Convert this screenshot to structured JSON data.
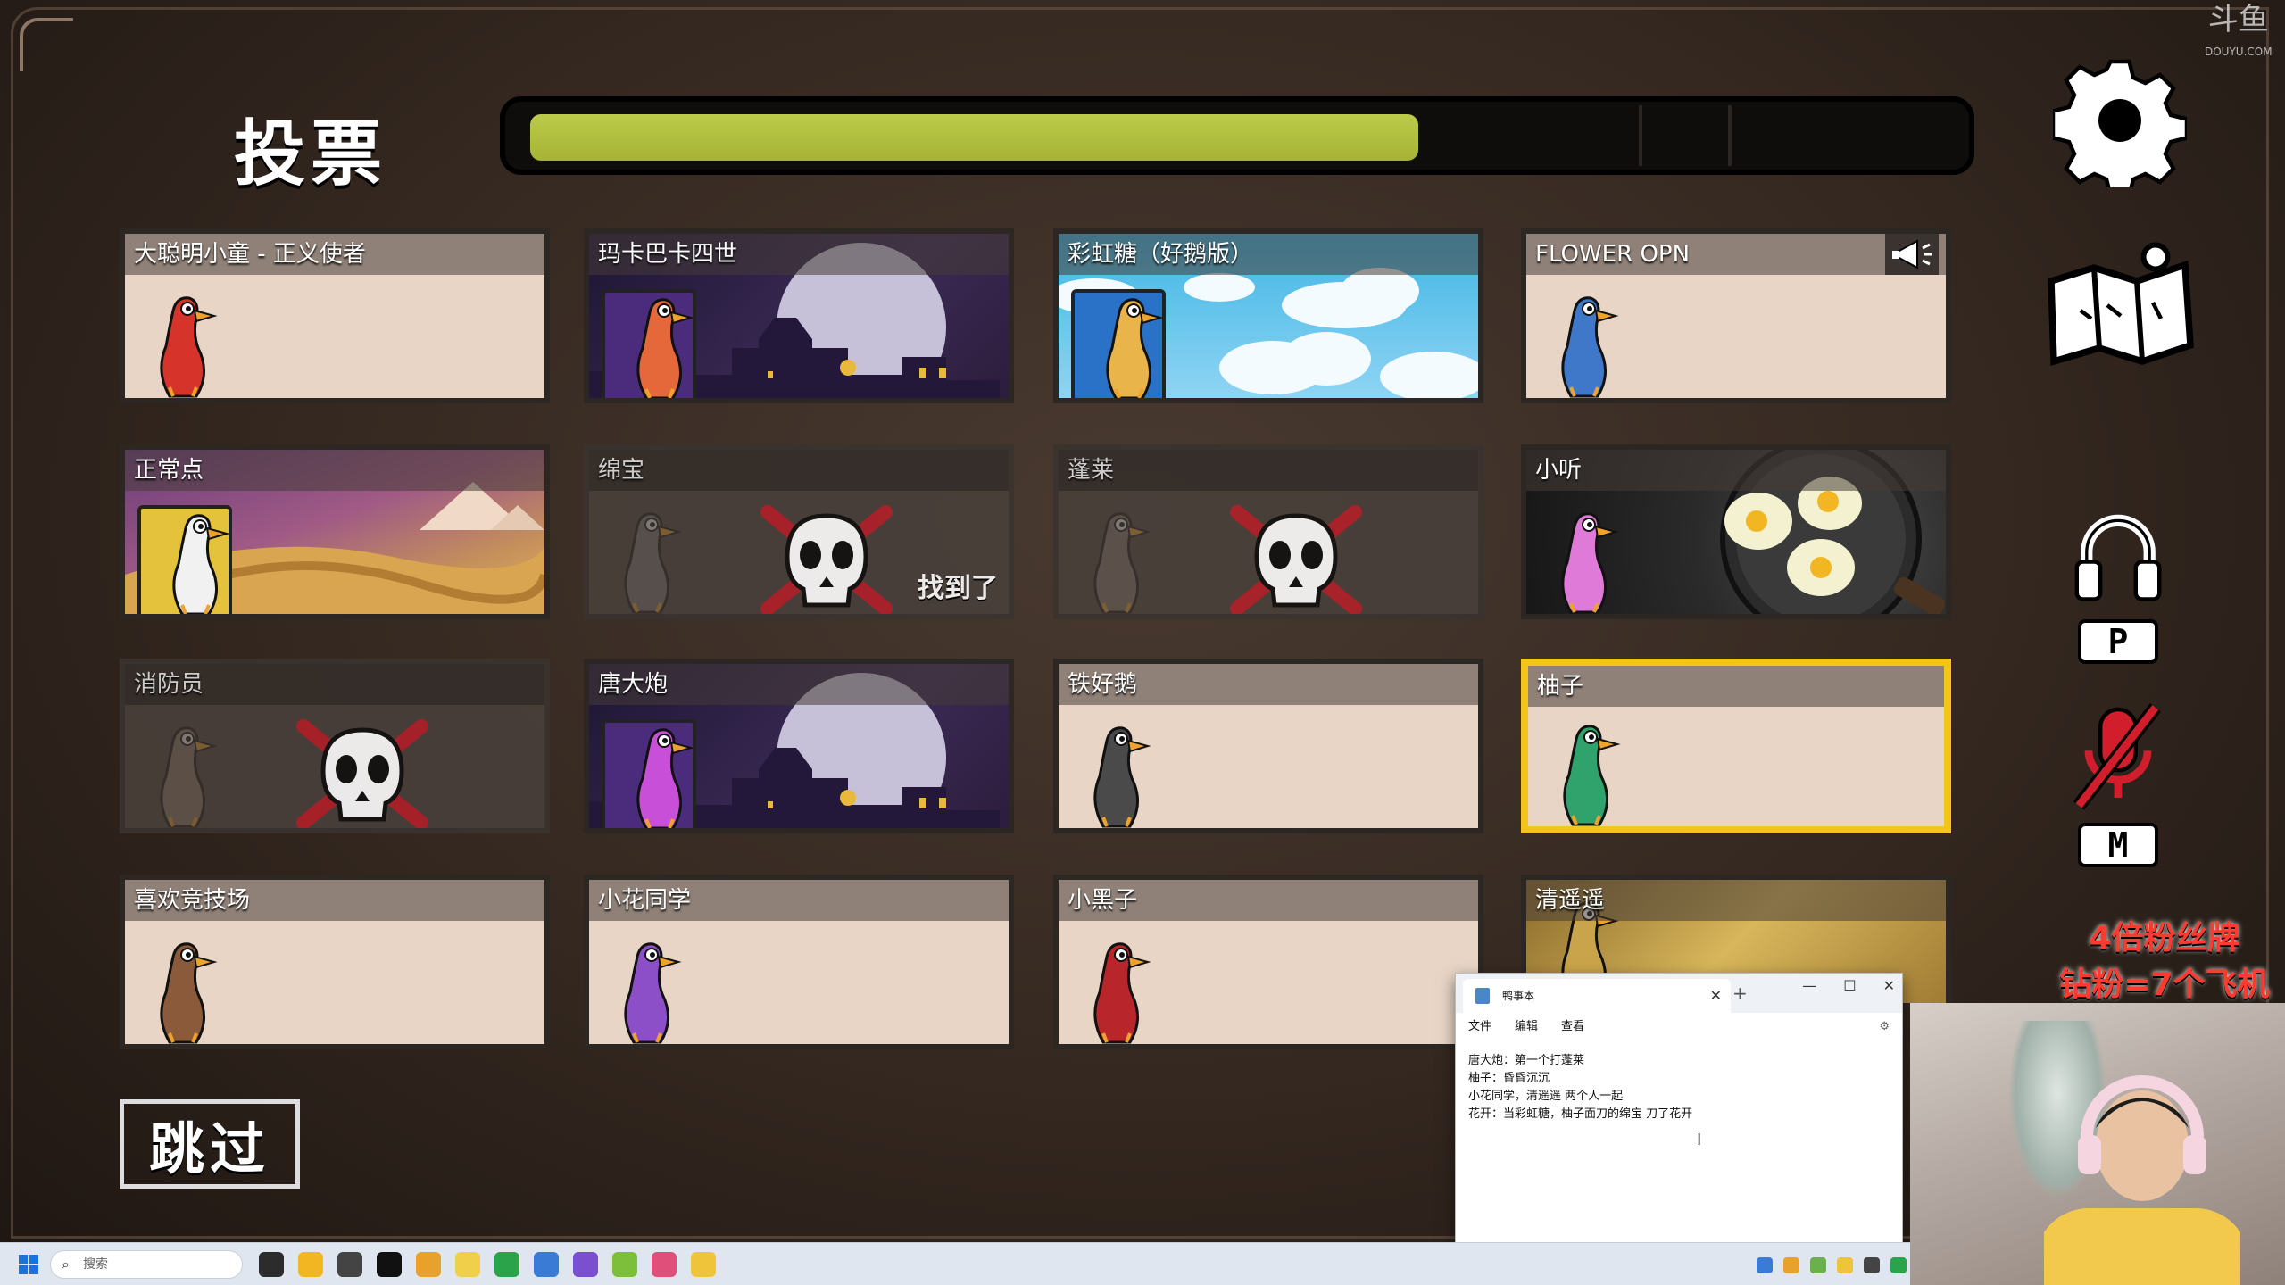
{
  "header": {
    "title": "投票",
    "timer_progress": 0.63
  },
  "players": [
    {
      "name": "大聪明小童 - 正义使者",
      "status": "alive",
      "bg": "plain",
      "goose_color": "#d6332b"
    },
    {
      "name": "玛卡巴卡四世",
      "status": "alive",
      "bg": "night",
      "goose_color": "#e4683a"
    },
    {
      "name": "彩虹糖（好鹅版）",
      "status": "alive",
      "bg": "sky",
      "goose_color": "#e9b54a"
    },
    {
      "name": "FLOWER OPN",
      "status": "alive",
      "bg": "plain",
      "goose_color": "#3f77c9",
      "megaphone": true
    },
    {
      "name": "正常点",
      "status": "alive",
      "bg": "desert",
      "goose_color": "#f1f1f1"
    },
    {
      "name": "绵宝",
      "status": "dead",
      "bg": "dead",
      "goose_color": "#777",
      "found_label": "找到了"
    },
    {
      "name": "蓬莱",
      "status": "dead",
      "bg": "dead",
      "goose_color": "#8a7a70"
    },
    {
      "name": "小听",
      "status": "alive",
      "bg": "pan",
      "goose_color": "#e07ad9"
    },
    {
      "name": "消防员",
      "status": "dead",
      "bg": "dead",
      "goose_color": "#8c7a6a"
    },
    {
      "name": "唐大炮",
      "status": "alive",
      "bg": "night",
      "goose_color": "#c84fd8"
    },
    {
      "name": "铁好鹅",
      "status": "alive",
      "bg": "plain",
      "goose_color": "#4a4a4a"
    },
    {
      "name": "柚子",
      "status": "alive",
      "bg": "plain",
      "goose_color": "#2fa36b",
      "selected": true
    },
    {
      "name": "喜欢竞技场",
      "status": "alive",
      "bg": "plain",
      "goose_color": "#8a5a3b"
    },
    {
      "name": "小花同学",
      "status": "alive",
      "bg": "plain",
      "goose_color": "#8c4fc8"
    },
    {
      "name": "小黑子",
      "status": "alive",
      "bg": "plain",
      "goose_color": "#b8252a"
    },
    {
      "name": "清遥遥",
      "status": "alive",
      "bg": "gold",
      "goose_color": "#c9a44b"
    }
  ],
  "skip_label": "跳过",
  "key_hints": {
    "push_to_talk": "P",
    "mute": "M"
  },
  "overlays": {
    "watermark_main": "斗鱼",
    "watermark_sub": "DOUYU.COM",
    "promo_line1": "4倍粉丝牌",
    "promo_line2": "钻粉=7个飞机"
  },
  "notepad": {
    "tab_title": "鸭事本",
    "new_tab": "+",
    "menu": [
      "文件",
      "编辑",
      "查看"
    ],
    "lines": [
      "唐大炮：第一个打蓬莱",
      "柚子：昏昏沉沉",
      "小花同学，清遥遥 两个人一起",
      "花开：当彩虹糖，柚子面刀的绵宝 刀了花开"
    ]
  },
  "taskbar": {
    "search_placeholder": "搜索"
  },
  "colors": {
    "timer_fill": "#bccb49",
    "selected_border": "#f3c419",
    "dead_x": "#b3202a"
  }
}
